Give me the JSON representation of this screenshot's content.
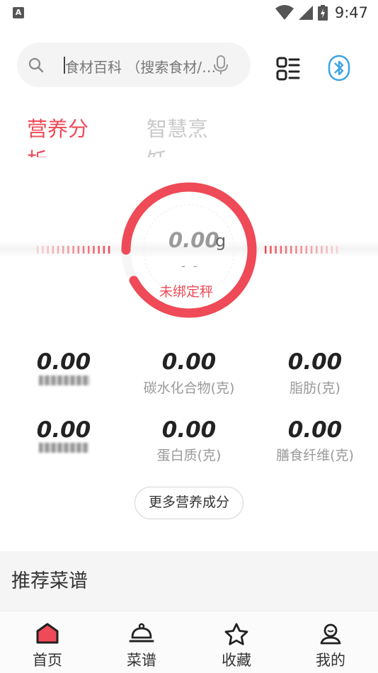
{
  "status_bar": {
    "time": "9:47",
    "app_badge": "A"
  },
  "search": {
    "placeholder": "食材百科 （搜索食材/食物）"
  },
  "tabs": [
    {
      "label": "营养分析"
    },
    {
      "label": "智慧烹饪"
    }
  ],
  "gauge": {
    "value": "0.00",
    "unit": "g",
    "dash": "- -",
    "status": "未绑定秤",
    "accent_color": "#ef4a57",
    "fill_fraction": 0.92
  },
  "nutrients": [
    {
      "value": "0.00",
      "label": ""
    },
    {
      "value": "0.00",
      "label": "碳水化合物(克)"
    },
    {
      "value": "0.00",
      "label": "脂肪(克)"
    },
    {
      "value": "0.00",
      "label": ""
    },
    {
      "value": "0.00",
      "label": "蛋白质(克)"
    },
    {
      "value": "0.00",
      "label": "膳食纤维(克)"
    }
  ],
  "more_button": {
    "label": "更多营养成分"
  },
  "recommend": {
    "title": "推荐菜谱"
  },
  "bottom_nav": [
    {
      "label": "首页",
      "icon": "home-icon",
      "active": true
    },
    {
      "label": "菜谱",
      "icon": "cloche-icon",
      "active": false
    },
    {
      "label": "收藏",
      "icon": "star-icon",
      "active": false
    },
    {
      "label": "我的",
      "icon": "profile-icon",
      "active": false
    }
  ]
}
